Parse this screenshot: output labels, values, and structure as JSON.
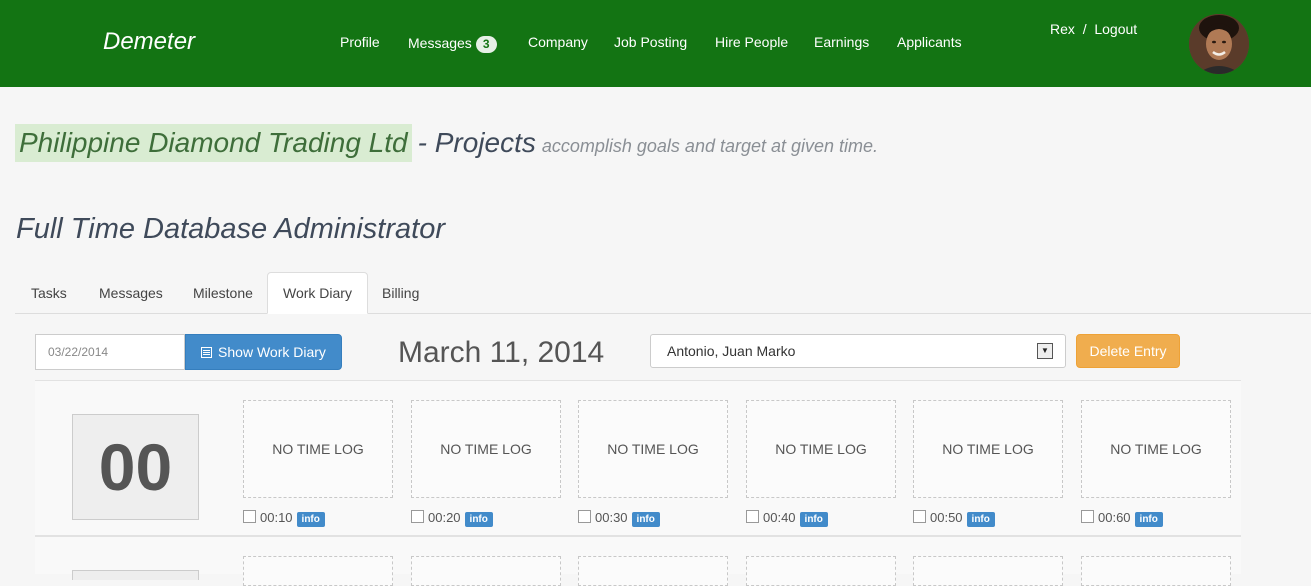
{
  "navbar": {
    "brand": "Demeter",
    "links": [
      "Profile",
      "Messages",
      "Company",
      "Job Posting",
      "Hire People",
      "Earnings",
      "Applicants"
    ],
    "messages_badge": "3",
    "user_name": "Rex",
    "separator": "/",
    "logout": "Logout"
  },
  "header": {
    "company": "Philippine Diamond Trading Ltd",
    "projects_title": "- Projects",
    "subtitle": "accomplish goals and target at given time.",
    "job_title": "Full Time Database Administrator"
  },
  "tabs": [
    "Tasks",
    "Messages",
    "Milestone",
    "Work Diary",
    "Billing"
  ],
  "active_tab": "Work Diary",
  "toolbar": {
    "date_value": "03/22/2014",
    "show_button": "Show Work Diary",
    "display_date": "March 11, 2014",
    "selected_person": "Antonio, Juan Marko",
    "delete_button": "Delete Entry"
  },
  "diary": {
    "hour": "00",
    "slot_text": "NO TIME LOG",
    "times": [
      "00:10",
      "00:20",
      "00:30",
      "00:40",
      "00:50",
      "00:60"
    ],
    "info_label": "info"
  },
  "colors": {
    "navbar": "#137413",
    "primary": "#428bca",
    "warning": "#f0ad4e",
    "company_highlight": "#d9ecd2"
  }
}
